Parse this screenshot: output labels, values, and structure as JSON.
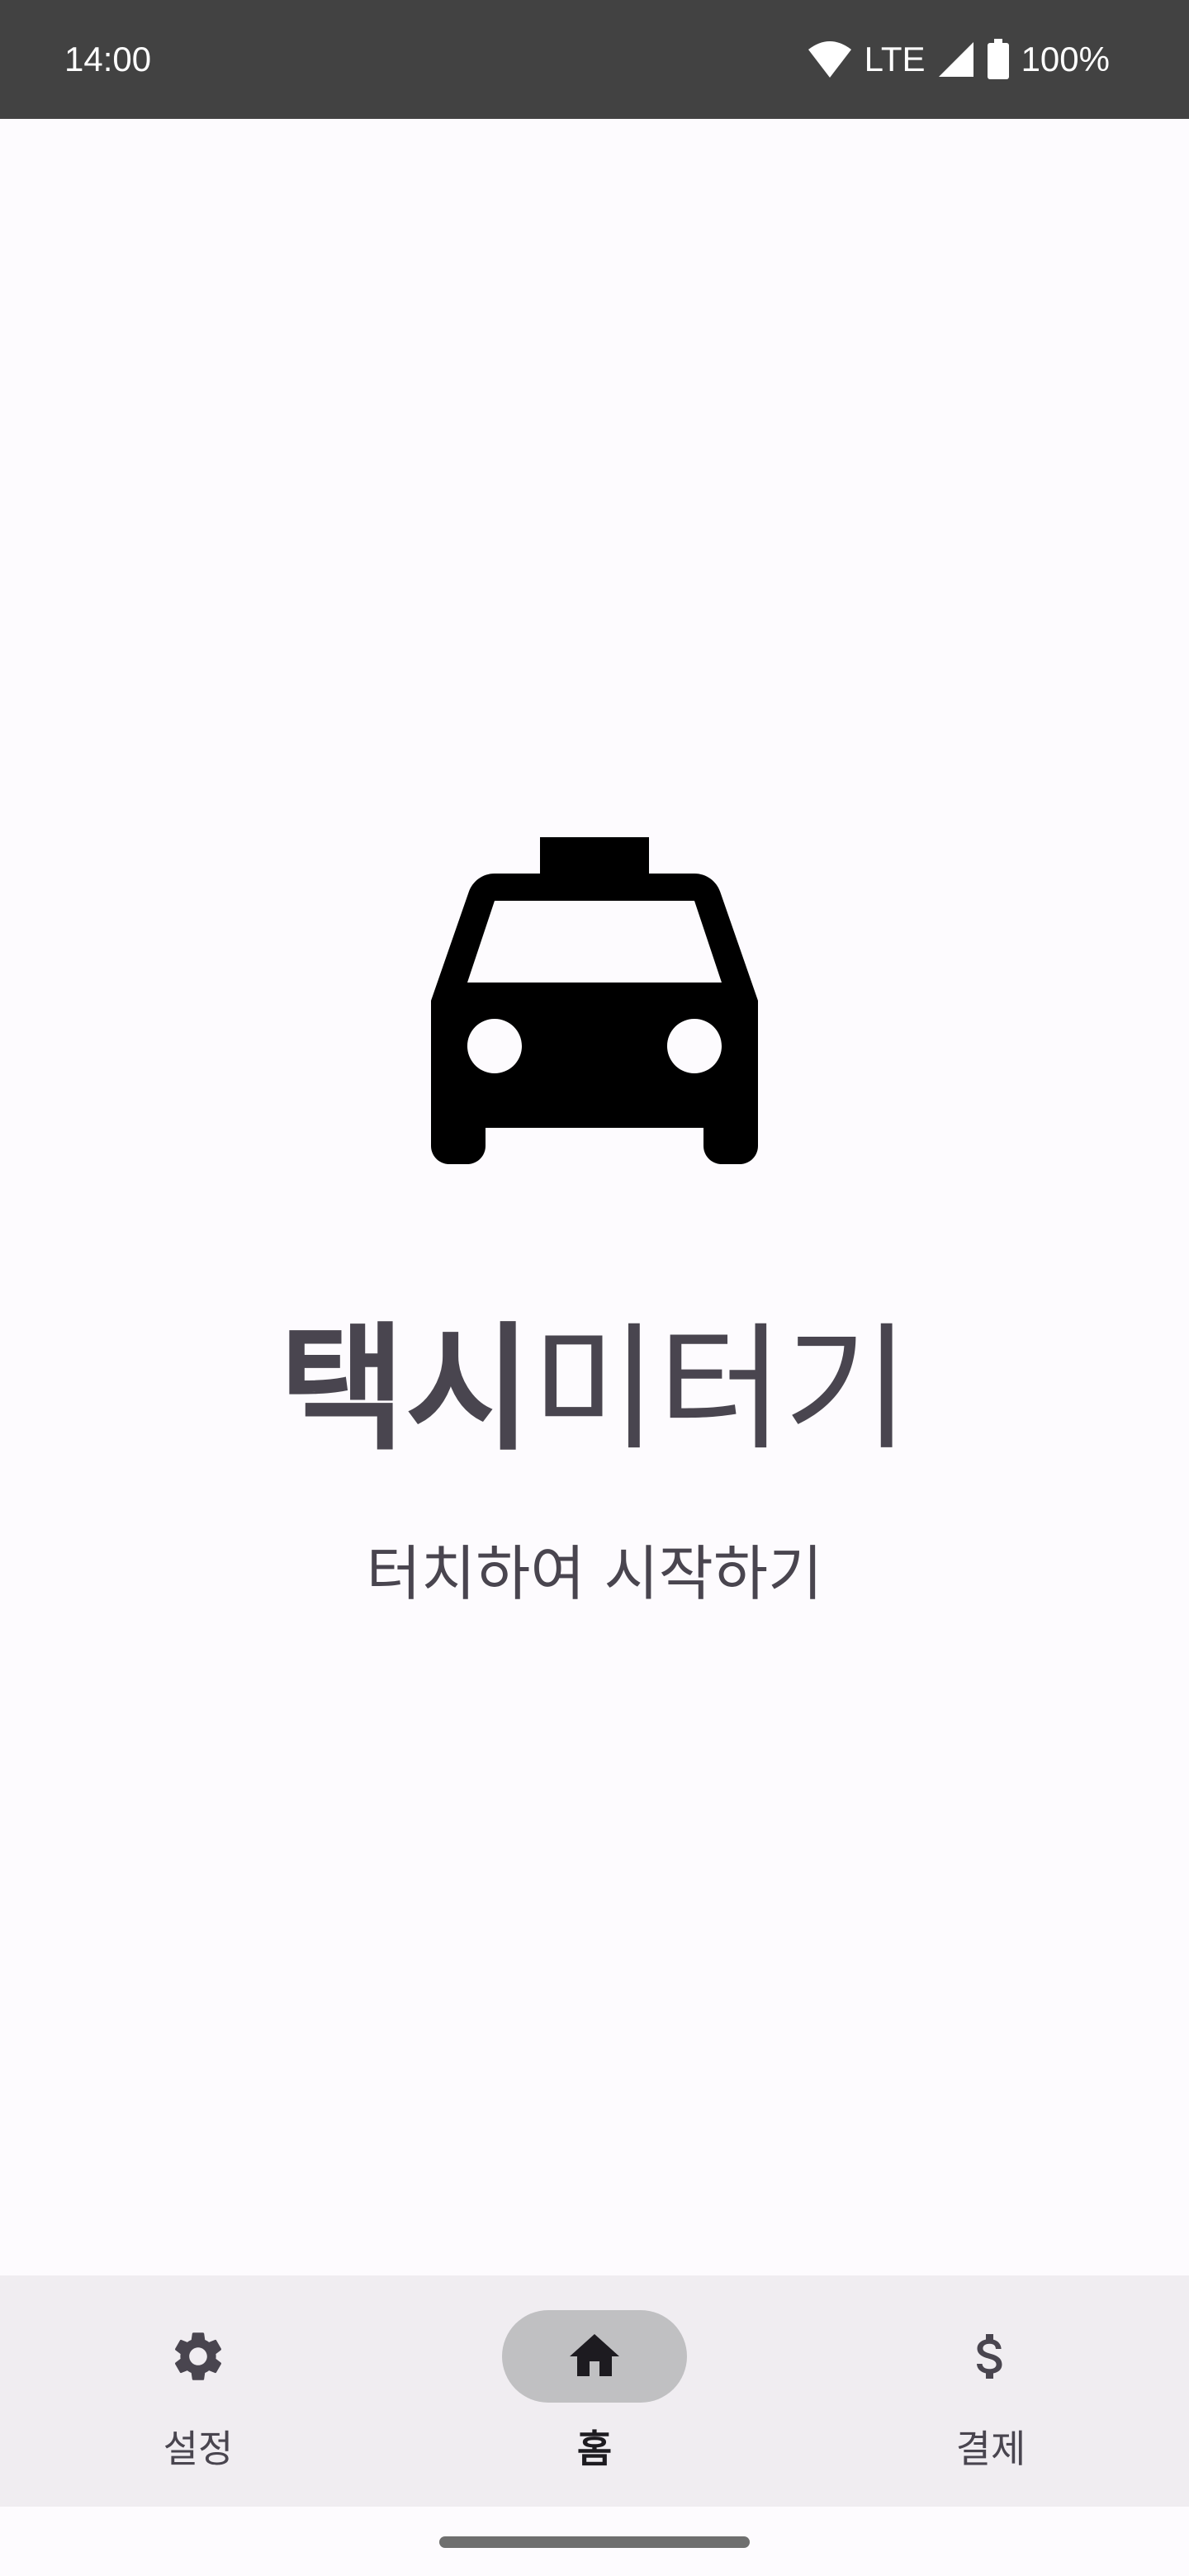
{
  "status_bar": {
    "time": "14:00",
    "network": "LTE",
    "battery": "100%",
    "icons": [
      "wifi-icon",
      "signal-icon",
      "battery-icon"
    ]
  },
  "main": {
    "icon": "taxi-icon",
    "title_bold": "택시",
    "title_regular": "미터기",
    "subtitle": "터치하여 시작하기"
  },
  "bottom_nav": {
    "items": [
      {
        "label": "설정",
        "icon": "gear-icon",
        "selected": false
      },
      {
        "label": "홈",
        "icon": "home-icon",
        "selected": true
      },
      {
        "label": "결제",
        "icon": "dollar-icon",
        "selected": false
      }
    ]
  },
  "colors": {
    "status_bar_bg": "#424242",
    "background": "#FDFBFE",
    "nav_bg": "#F0EDF1",
    "active_pill": "#C0C0C2",
    "text": "#49454F",
    "active_text": "#1D1B20"
  }
}
